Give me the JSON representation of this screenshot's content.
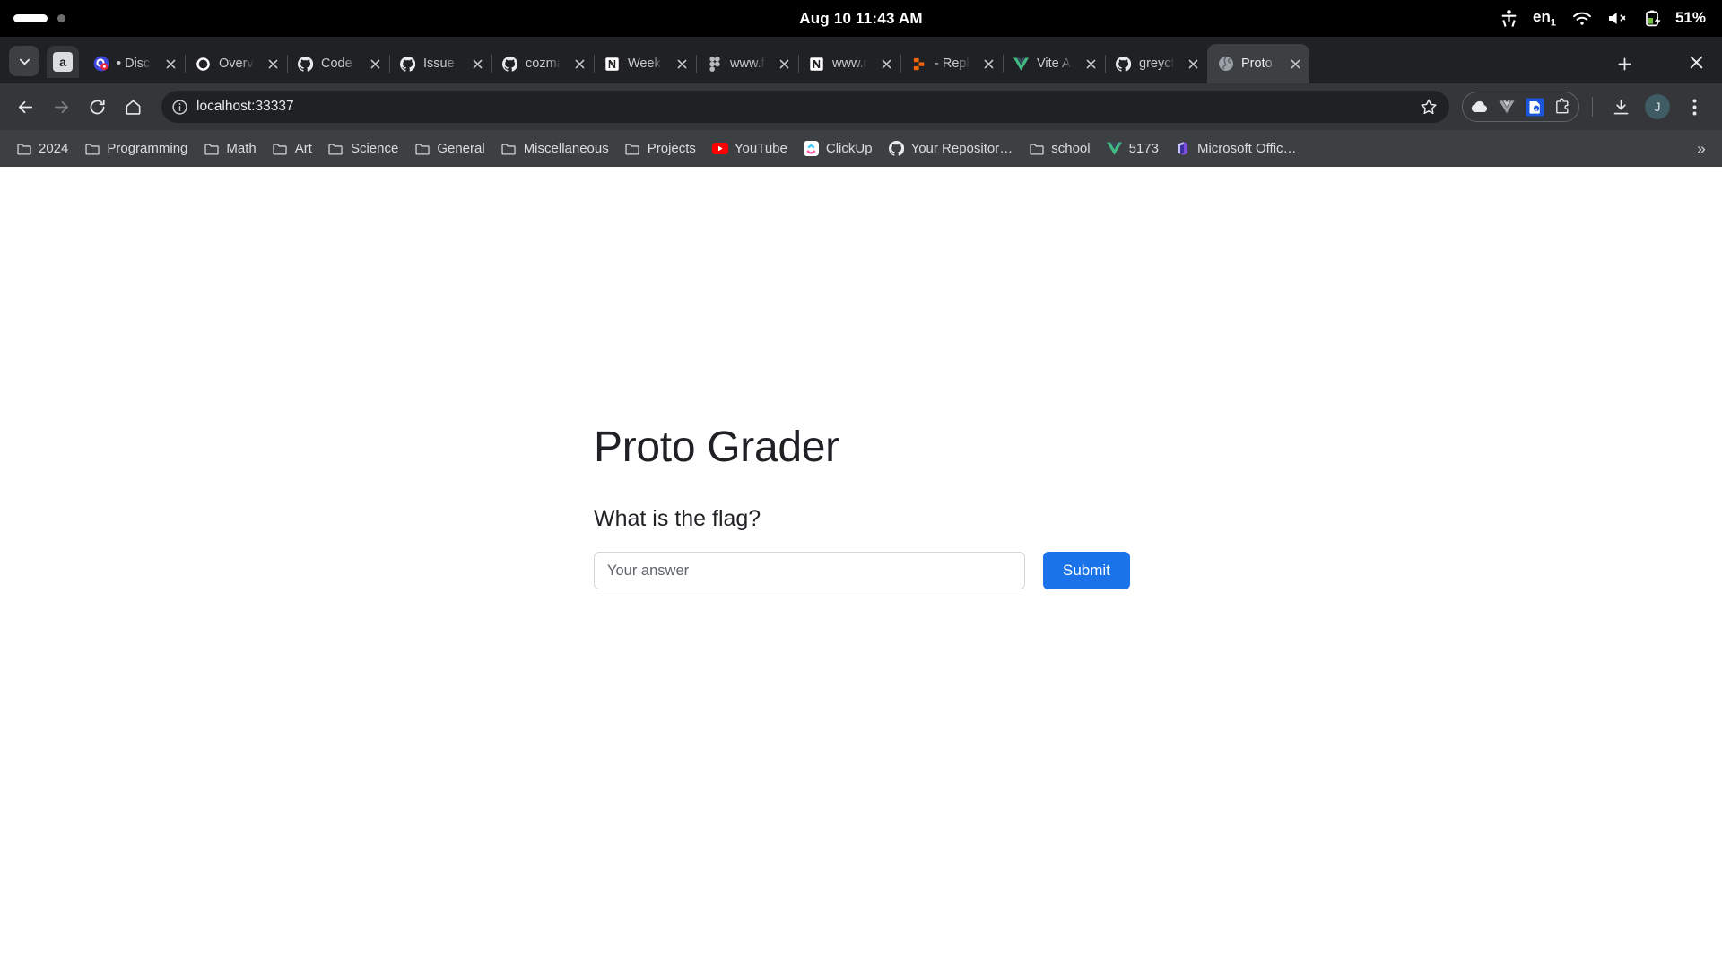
{
  "system_bar": {
    "activities_label": "",
    "clock": "Aug 10  11:43 AM",
    "accessibility_icon": "accessibility-icon",
    "keyboard_layout": "en",
    "keyboard_layout_index": "1",
    "wifi_icon": "wifi-icon",
    "volume_icon": "volume-muted-icon",
    "battery_icon": "battery-charging-icon",
    "battery_percent": "51%"
  },
  "browser": {
    "tab_search_icon": "chevron-down-icon",
    "pinned_tab": {
      "label": "a",
      "name": "pinned-tab-a"
    },
    "new_tab_label": "+",
    "window_close_label": "✕",
    "tabs": [
      {
        "title": "• Disc",
        "favicon": "discord-icon",
        "active": false
      },
      {
        "title": "Overv",
        "favicon": "circle-icon",
        "active": false
      },
      {
        "title": "Code s",
        "favicon": "github-icon",
        "active": false
      },
      {
        "title": "Issue s",
        "favicon": "github-icon",
        "active": false
      },
      {
        "title": "cozma",
        "favicon": "github-icon",
        "active": false
      },
      {
        "title": "Week",
        "favicon": "notion-icon",
        "active": false
      },
      {
        "title": "www.f",
        "favicon": "figma-icon",
        "active": false
      },
      {
        "title": "www.n",
        "favicon": "notion-icon",
        "active": false
      },
      {
        "title": "- Repl",
        "favicon": "replit-icon",
        "active": false
      },
      {
        "title": "Vite A",
        "favicon": "vite-vue-icon",
        "active": false
      },
      {
        "title": "greyct",
        "favicon": "github-icon",
        "active": false
      },
      {
        "title": "Proto",
        "favicon": "globe-icon",
        "active": true
      }
    ],
    "toolbar": {
      "back_icon": "back-arrow-icon",
      "forward_icon": "forward-arrow-icon",
      "reload_icon": "reload-icon",
      "home_icon": "home-icon",
      "site_info_icon": "info-circle-icon",
      "url": "localhost:33337",
      "bookmark_star_icon": "star-icon",
      "extensions": [
        {
          "name": "cloud-extension-icon"
        },
        {
          "name": "vue-devtools-extension-icon"
        },
        {
          "name": "password-manager-extension-icon"
        },
        {
          "name": "extensions-puzzle-icon"
        }
      ],
      "download_icon": "download-icon",
      "profile_initial": "J",
      "menu_icon": "three-dot-menu-icon"
    },
    "bookmarks": [
      {
        "label": "2024",
        "icon": "folder-icon"
      },
      {
        "label": "Programming",
        "icon": "folder-icon"
      },
      {
        "label": "Math",
        "icon": "folder-icon"
      },
      {
        "label": "Art",
        "icon": "folder-icon"
      },
      {
        "label": "Science",
        "icon": "folder-icon"
      },
      {
        "label": "General",
        "icon": "folder-icon"
      },
      {
        "label": "Miscellaneous",
        "icon": "folder-icon"
      },
      {
        "label": "Projects",
        "icon": "folder-icon"
      },
      {
        "label": "YouTube",
        "icon": "youtube-icon"
      },
      {
        "label": "ClickUp",
        "icon": "clickup-icon"
      },
      {
        "label": "Your Repositor…",
        "icon": "github-icon"
      },
      {
        "label": "school",
        "icon": "folder-icon"
      },
      {
        "label": "5173",
        "icon": "vue-icon"
      },
      {
        "label": "Microsoft Offic…",
        "icon": "microsoft-office-icon"
      }
    ],
    "bookmarks_overflow_label": "»"
  },
  "page": {
    "title": "Proto Grader",
    "question": "What is the flag?",
    "answer_placeholder": "Your answer",
    "answer_value": "",
    "submit_label": "Submit",
    "accent_color": "#1a73e8"
  }
}
